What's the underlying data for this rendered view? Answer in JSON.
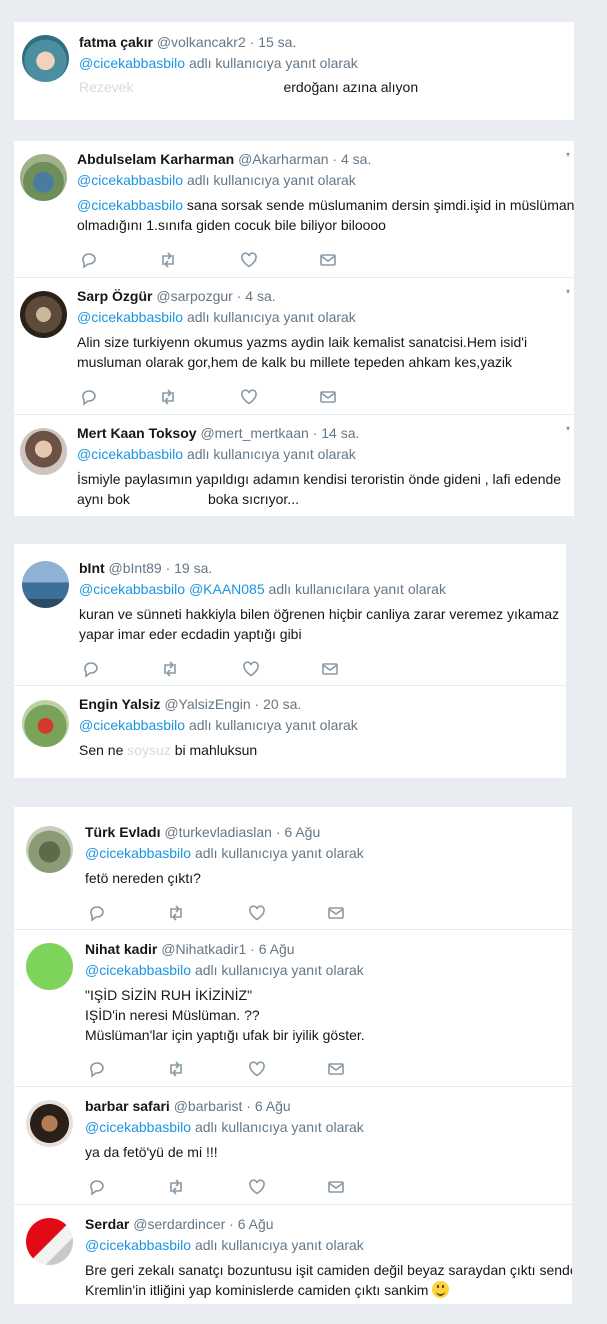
{
  "reply_prefix": "adlı kullanıcıya yanıt olarak",
  "reply_prefix_plural": "adlı kullanıcılara yanıt olarak",
  "colors": {
    "accent": "#1b95e0",
    "muted": "#657786",
    "text": "#14171a",
    "background": "#e9edf1"
  },
  "icons": [
    "reply-icon",
    "retweet-icon",
    "like-icon",
    "message-icon"
  ],
  "tweets": [
    {
      "name": "fatma çakır",
      "handle": "@volkancakr2",
      "time": "15 sa.",
      "reply_to": "@cicekabbasbilo",
      "text_faded": "Rezevek",
      "text_visible": "erdoğanı azına alıyon"
    },
    {
      "name": "Abdulselam Karharman",
      "handle": "@Akarharman",
      "time": "4 sa.",
      "reply_to": "@cicekabbasbilo",
      "text_mention": "@cicekabbasbilo",
      "text_line1": " sana sorsak sende müslumanim dersin şimdi.işid in müslüman",
      "text_line2": "olmadığını 1.sınıfa giden cocuk bile biliyor biloooo"
    },
    {
      "name": "Sarp Özgür",
      "handle": "@sarpozgur",
      "time": "4 sa.",
      "reply_to": "@cicekabbasbilo",
      "text_line1": "Alin size turkiyenn okumus yazms aydin laik kemalist sanatcisi.Hem isid'i",
      "text_line2": "musluman olarak gor,hem de kalk bu millete tepeden ahkam kes,yazik"
    },
    {
      "name": "Mert Kaan Toksoy",
      "handle": "@mert_mertkaan",
      "time": "14 sa.",
      "reply_to": "@cicekabbasbilo",
      "text_line1": "İsmiyle paylasımın yapıldıgı adamın kendisi teroristin önde gideni , lafi edende",
      "text_line2_a": "aynı bok",
      "text_line2_b": "boka sıcrıyor..."
    },
    {
      "name": "bInt",
      "handle": "@bInt89",
      "time": "19 sa.",
      "reply_to": "@cicekabbasbilo",
      "reply_to_2": "@KAAN085",
      "text_line1": "kuran ve sünneti hakkiyla bilen öğrenen hiçbir canliya zarar veremez  yıkamaz",
      "text_line2": "yapar imar eder ecdadin yaptığı gibi"
    },
    {
      "name": "Engin Yalsiz",
      "handle": "@YalsizEngin",
      "time": "20 sa.",
      "reply_to": "@cicekabbasbilo",
      "text_a": "Sen ne ",
      "text_faded": "soysuz",
      "text_b": " bi mahluksun"
    },
    {
      "name": "Türk Evladı",
      "handle": "@turkevladiaslan",
      "time": "6 Ağu",
      "reply_to": "@cicekabbasbilo",
      "text_line1": "fetö nereden çıktı?"
    },
    {
      "name": "Nihat kadir",
      "handle": "@Nihatkadir1",
      "time": "6 Ağu",
      "reply_to": "@cicekabbasbilo",
      "text_line1": "\"IŞİD SİZİN RUH İKİZİNİZ\"",
      "text_line2": "IŞİD'in neresi Müslüman. ??",
      "text_line3": "Müslüman'lar için yaptığı ufak bir iyilik göster."
    },
    {
      "name": "barbar safari",
      "handle": "@barbarist",
      "time": "6 Ağu",
      "reply_to": "@cicekabbasbilo",
      "text_line1": "ya da fetö'yü de mi !!!"
    },
    {
      "name": "Serdar",
      "handle": "@serdardincer",
      "time": "6 Ağu",
      "reply_to": "@cicekabbasbilo",
      "text_line1": "Bre geri zekalı sanatçı bozuntusu işit camiden değil beyaz saraydan çıktı sende",
      "text_line2": "Kremlin'in itliğini yap kominislerde camiden çıktı sankim"
    }
  ]
}
